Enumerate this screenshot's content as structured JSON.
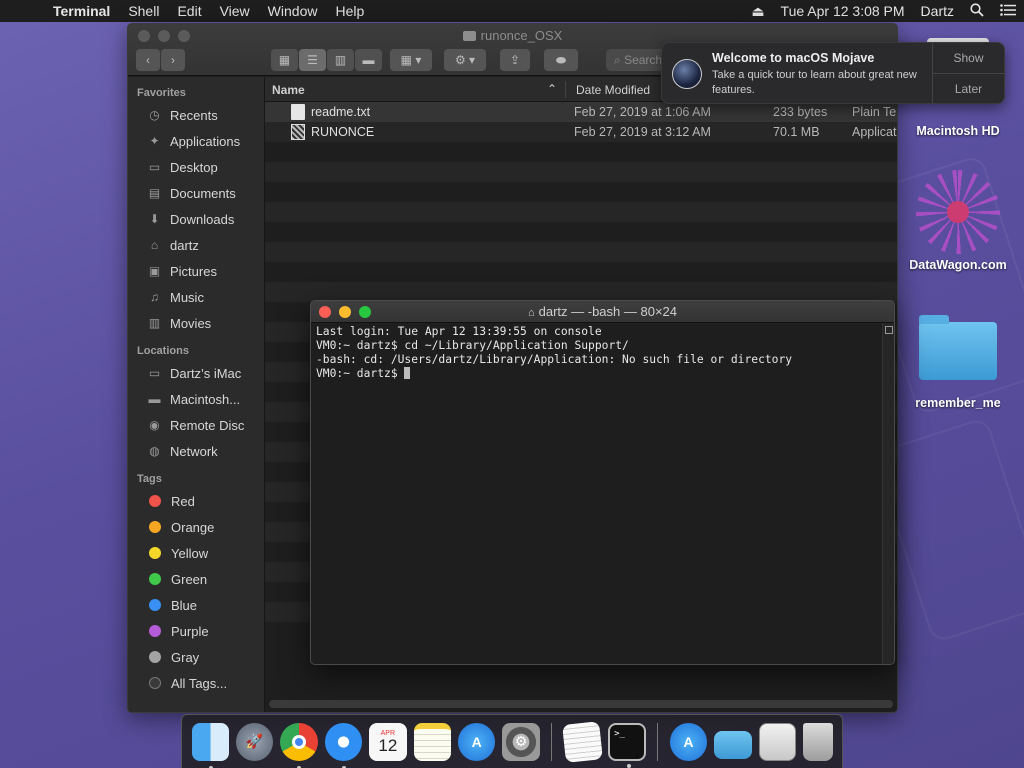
{
  "menubar": {
    "app": "Terminal",
    "menus": [
      "Shell",
      "Edit",
      "View",
      "Window",
      "Help"
    ],
    "clock": "Tue Apr 12  3:08 PM",
    "user": "Dartz"
  },
  "finder": {
    "title": "runonce_OSX",
    "search_placeholder": "Search",
    "sidebar": {
      "favorites_heading": "Favorites",
      "favorites": [
        "Recents",
        "Applications",
        "Desktop",
        "Documents",
        "Downloads",
        "dartz",
        "Pictures",
        "Music",
        "Movies"
      ],
      "locations_heading": "Locations",
      "locations": [
        "Dartz’s iMac",
        "Macintosh...",
        "Remote Disc",
        "Network"
      ],
      "tags_heading": "Tags",
      "tags": [
        {
          "label": "Red",
          "color": "#f0534c"
        },
        {
          "label": "Orange",
          "color": "#f6a623"
        },
        {
          "label": "Yellow",
          "color": "#f5d72a"
        },
        {
          "label": "Green",
          "color": "#41c94b"
        },
        {
          "label": "Blue",
          "color": "#3a8ff5"
        },
        {
          "label": "Purple",
          "color": "#b45bd8"
        },
        {
          "label": "Gray",
          "color": "#a3a3a3"
        },
        {
          "label": "All Tags...",
          "color": "#3a3a3a"
        }
      ]
    },
    "columns": {
      "name": "Name",
      "date": "Date Modified"
    },
    "files": [
      {
        "name": "readme.txt",
        "date": "Feb 27, 2019 at 1:06 AM",
        "size": "233 bytes",
        "kind": "Plain Te"
      },
      {
        "name": "RUNONCE",
        "date": "Feb 27, 2019 at 3:12 AM",
        "size": "70.1 MB",
        "kind": "Applicat"
      }
    ]
  },
  "notification": {
    "title": "Welcome to macOS Mojave",
    "body": "Take a quick tour to learn about great new features.",
    "show": "Show",
    "later": "Later"
  },
  "desktop": {
    "hd": "Macintosh HD",
    "dw": "DataWagon.com",
    "folder": "remember_me"
  },
  "terminal": {
    "title": "dartz — -bash — 80×24",
    "lines": [
      "Last login: Tue Apr 12 13:39:55 on console",
      "VM0:~ dartz$ cd ~/Library/Application Support/",
      "-bash: cd: /Users/dartz/Library/Application: No such file or directory",
      "VM0:~ dartz$ "
    ]
  },
  "dock": {
    "calendar_month": "APR",
    "calendar_day": "12"
  }
}
